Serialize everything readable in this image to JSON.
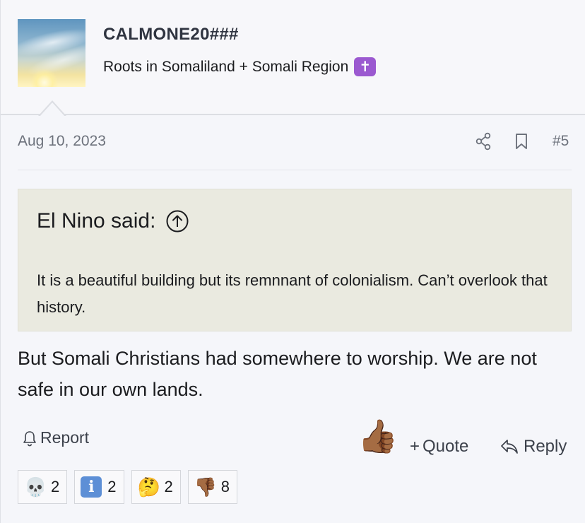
{
  "user": {
    "name": "CALMONE20###",
    "title": "Roots in Somaliland + Somali Region",
    "title_badge": "✝"
  },
  "post": {
    "date": "Aug 10, 2023",
    "number": "#5",
    "quote": {
      "attribution": "El Nino said:",
      "text": "It is a beautiful building but its remnnant of colonialism. Can’t overlook that history."
    },
    "body": "But Somali Christians had somewhere to worship. We are not safe in our own lands."
  },
  "actions": {
    "report_label": "Report",
    "like_emoji": "👍🏾",
    "quote_label": "Quote",
    "reply_label": "Reply"
  },
  "reactions": [
    {
      "emoji": "💀",
      "count": "2"
    },
    {
      "emoji": "i",
      "count": "2"
    },
    {
      "emoji": "🤔",
      "count": "2"
    },
    {
      "emoji": "👎🏾",
      "count": "8"
    }
  ],
  "colors": {
    "quote_bg": "#eaeae0",
    "header_bg": "#f7f7fa",
    "page_bg": "#f5f6fa",
    "badge": "#9b59d0"
  }
}
